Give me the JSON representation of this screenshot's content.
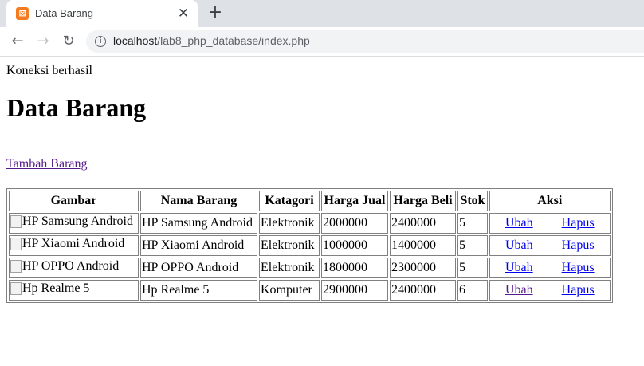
{
  "browser": {
    "tab_title": "Data Barang",
    "url_host": "localhost",
    "url_path": "/lab8_php_database/index.php"
  },
  "page": {
    "status": "Koneksi berhasil",
    "title": "Data Barang",
    "add_link": "Tambah Barang"
  },
  "table": {
    "headers": [
      "Gambar",
      "Nama Barang",
      "Katagori",
      "Harga Jual",
      "Harga Beli",
      "Stok",
      "Aksi"
    ],
    "rows": [
      {
        "gambar_alt": "HP Samsung Android",
        "nama": "HP Samsung Android",
        "kategori": "Elektronik",
        "harga_jual": "2000000",
        "harga_beli": "2400000",
        "stok": "5",
        "ubah": "Ubah",
        "hapus": "Hapus"
      },
      {
        "gambar_alt": "HP Xiaomi Android",
        "nama": "HP Xiaomi Android",
        "kategori": "Elektronik",
        "harga_jual": "1000000",
        "harga_beli": "1400000",
        "stok": "5",
        "ubah": "Ubah",
        "hapus": "Hapus"
      },
      {
        "gambar_alt": "HP OPPO Android",
        "nama": "HP OPPO Android",
        "kategori": "Elektronik",
        "harga_jual": "1800000",
        "harga_beli": "2300000",
        "stok": "5",
        "ubah": "Ubah",
        "hapus": "Hapus"
      },
      {
        "gambar_alt": "Hp Realme 5",
        "nama": "Hp Realme 5",
        "kategori": "Komputer",
        "harga_jual": "2900000",
        "harga_beli": "2400000",
        "stok": "6",
        "ubah": "Ubah",
        "hapus": "Hapus"
      }
    ]
  },
  "colors": {
    "link": "#0000ee",
    "visited_link": "#551a8b",
    "tab_strip": "#dee1e6",
    "favicon": "#f47b20"
  },
  "icons": [
    "xampp-favicon-icon",
    "close-icon",
    "plus-icon",
    "back-arrow-icon",
    "forward-arrow-icon",
    "reload-icon",
    "info-icon",
    "broken-image-icon"
  ]
}
